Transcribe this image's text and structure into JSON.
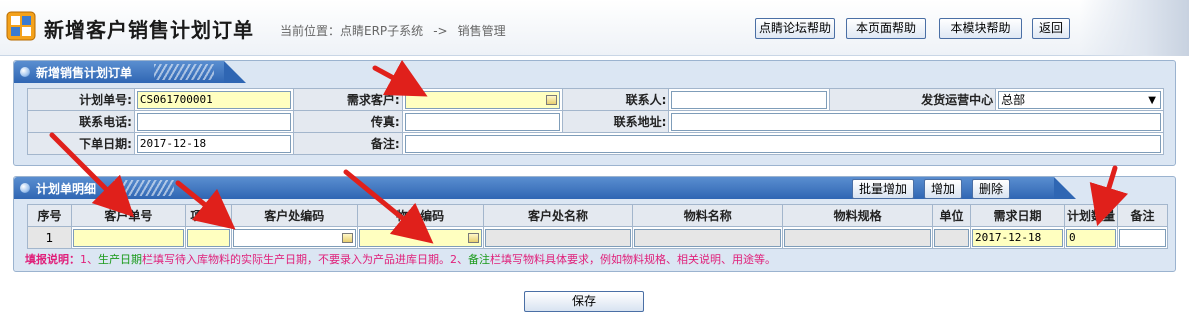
{
  "header": {
    "title": "新增客户销售计划订单",
    "breadcrumb": {
      "label": "当前位置：",
      "system": "点睛ERP子系统",
      "separator": "->",
      "module": "销售管理"
    },
    "buttons": {
      "forum_help": "点睛论坛帮助",
      "page_help": "本页面帮助",
      "module_help": "本模块帮助",
      "back": "返回"
    }
  },
  "order_panel": {
    "title": "新增销售计划订单",
    "fields": {
      "plan_no_label": "计划单号:",
      "plan_no_value": "CS061700001",
      "customer_label": "需求客户:",
      "contact_label": "联系人:",
      "center_label": "发货运营中心",
      "center_value": "总部",
      "phone_label": "联系电话:",
      "fax_label": "传真:",
      "address_label": "联系地址:",
      "date_label": "下单日期:",
      "date_value": "2017-12-18",
      "remark_label": "备注:"
    }
  },
  "detail_panel": {
    "title": "计划单明细",
    "buttons": {
      "batch_add": "批量增加",
      "add": "增加",
      "delete": "删除"
    },
    "columns": [
      "序号",
      "客户单号",
      "项目号",
      "客户处编码",
      "物料编码",
      "客户处名称",
      "物料名称",
      "物料规格",
      "单位",
      "需求日期",
      "计划数量",
      "备注"
    ],
    "rows": [
      {
        "index": "1",
        "demand_date": "2017-12-18",
        "quantity": "0"
      }
    ],
    "note": {
      "lead": "填报说明：",
      "p1": "1、",
      "f1": "生产日期",
      "p2": "栏填写待入库物料的实际生产日期，不要录入为产品进库日期。2、",
      "f2": "备注",
      "p3": "栏填写物料具体要求，例如物料规格、相关说明、用途等。"
    }
  },
  "footer": {
    "save": "保存"
  },
  "colors": {
    "accent": "#2f66b3",
    "required_field": "#ffffc0",
    "annotation_arrow": "#e0201b",
    "note_text": "#e0207a",
    "note_field": "#1a9a1a"
  }
}
